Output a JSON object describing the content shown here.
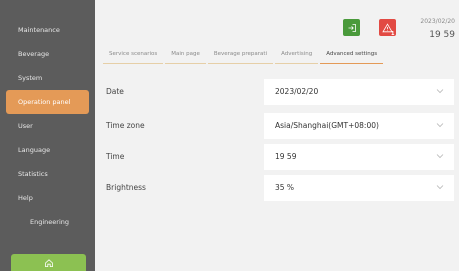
{
  "sidebar": {
    "items": [
      {
        "label": "Maintenance"
      },
      {
        "label": "Beverage"
      },
      {
        "label": "System"
      },
      {
        "label": "Operation panel"
      },
      {
        "label": "User"
      },
      {
        "label": "Language"
      },
      {
        "label": "Statistics"
      },
      {
        "label": "Help"
      },
      {
        "label": "Engineering"
      }
    ]
  },
  "header": {
    "date": "2023/02/20",
    "time": "19 59",
    "alert_count": "1"
  },
  "tabs": [
    {
      "label": "Service scenarios"
    },
    {
      "label": "Main page"
    },
    {
      "label": "Beverage preparati"
    },
    {
      "label": "Advertising"
    },
    {
      "label": "Advanced settings"
    }
  ],
  "settings": {
    "date": {
      "label": "Date",
      "value": "2023/02/20"
    },
    "timezone": {
      "label": "Time zone",
      "value": "Asia/Shanghai(GMT+08:00)"
    },
    "time": {
      "label": "Time",
      "value": "19 59"
    },
    "brightness": {
      "label": "Brightness",
      "value": "35 %"
    }
  },
  "colors": {
    "accent": "#e49a57",
    "home": "#8cc152",
    "login": "#4a9a3b",
    "alert": "#e24a43"
  },
  "icons": {
    "home": "home-icon",
    "login": "login-icon",
    "alert": "warning-icon",
    "dropdown": "chevron-down-icon"
  }
}
